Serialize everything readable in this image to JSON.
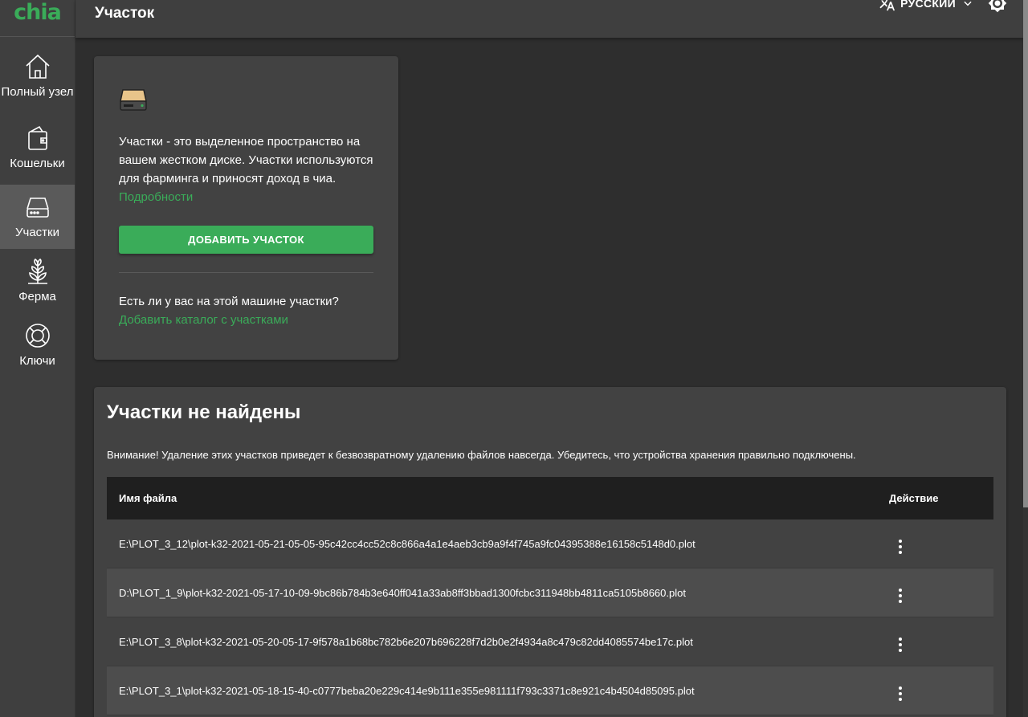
{
  "brand": {
    "logo_text": "chia",
    "accent": "#3aac59"
  },
  "header": {
    "title": "Участок",
    "language": "РУССКИЙ",
    "language_icon": "translate-icon",
    "theme_icon": "brightness-icon"
  },
  "sidebar": {
    "items": [
      {
        "label": "Полный узел",
        "icon": "home-icon",
        "active": false
      },
      {
        "label": "Кошельки",
        "icon": "wallet-icon",
        "active": false
      },
      {
        "label": "Участки",
        "icon": "hdd-icon",
        "active": true
      },
      {
        "label": "Ферма",
        "icon": "plant-icon",
        "active": false
      },
      {
        "label": "Ключи",
        "icon": "lifebuoy-icon",
        "active": false
      }
    ]
  },
  "info_card": {
    "description": "Участки - это выделенное пространство на вашем жестком диске. Участки используются для фарминга и приносят доход в чиа.",
    "learn_more": "Подробности",
    "add_button": "ДОБАВИТЬ УЧАСТОК",
    "question": "Есть ли у вас на этой машине участки?",
    "add_directory": "Добавить каталог с участками"
  },
  "missing_plots": {
    "title": "Участки не найдены",
    "warning": "Внимание! Удаление этих участков приведет к безвозвратному удалению файлов навсегда. Убедитесь, что устройства хранения правильно подключены.",
    "columns": {
      "name": "Имя файла",
      "action": "Действие"
    },
    "rows": [
      "E:\\PLOT_3_12\\plot-k32-2021-05-21-05-05-95c42cc4cc52c8c866a4a1e4aeb3cb9a9f4f745a9fc04395388e16158c5148d0.plot",
      "D:\\PLOT_1_9\\plot-k32-2021-05-17-10-09-9bc86b784b3e640ff041a33ab8ff3bbad1300fcbc311948bb4811ca5105b8660.plot",
      "E:\\PLOT_3_8\\plot-k32-2021-05-20-05-17-9f578a1b68bc782b6e207b696228f7d2b0e2f4934a8c479c82dd4085574be17c.plot",
      "E:\\PLOT_3_1\\plot-k32-2021-05-18-15-40-c0777beba20e229c414e9b111e355e981111f793c3371c8e921c4b4504d85095.plot"
    ]
  }
}
